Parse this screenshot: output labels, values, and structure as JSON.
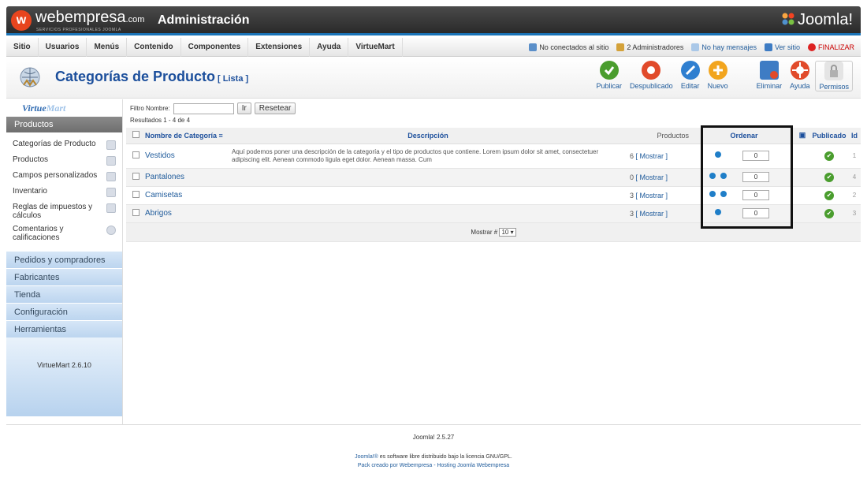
{
  "header": {
    "brand_text": "webempresa",
    "brand_suffix": ".com",
    "brand_sub": "SERVICIOS PROFESIONALES JOOMLA",
    "admin_title": "Administración",
    "joomla_label": "Joomla!"
  },
  "menu": {
    "items": [
      "Sitio",
      "Usuarios",
      "Menús",
      "Contenido",
      "Componentes",
      "Extensiones",
      "Ayuda",
      "VirtueMart"
    ]
  },
  "status": {
    "not_connected": "No conectados al sitio",
    "admins": "2 Administradores",
    "messages": "No hay mensajes",
    "view_site": "Ver sitio",
    "logout": "FINALIZAR"
  },
  "title": {
    "text": "Categorías de Producto",
    "suffix": "[ Lista ]"
  },
  "toolbar": {
    "publish": "Publicar",
    "unpublish": "Despublicado",
    "edit": "Editar",
    "new": "Nuevo",
    "delete": "Eliminar",
    "help": "Ayuda",
    "permissions": "Permisos"
  },
  "sidebar": {
    "logo_main": "Virtue",
    "logo_tail": "Mart",
    "heading": "Productos",
    "sub_items": [
      {
        "label": "Categorías de Producto",
        "icon": "folder-icon"
      },
      {
        "label": "Productos",
        "icon": "product-icon"
      },
      {
        "label": "Campos personalizados",
        "icon": "custom-fields-icon"
      },
      {
        "label": "Inventario",
        "icon": "inventory-icon"
      },
      {
        "label": "Reglas de impuestos y cálculos",
        "icon": "tax-icon"
      },
      {
        "label": "Comentarios y calificaciones",
        "icon": "comment-icon"
      }
    ],
    "sections": [
      "Pedidos y compradores",
      "Fabricantes",
      "Tienda",
      "Configuración",
      "Herramientas"
    ],
    "version": "VirtueMart 2.6.10"
  },
  "filter": {
    "label": "Filtro Nombre:",
    "value": "",
    "go": "Ir",
    "reset": "Resetear",
    "results": "Resultados 1 - 4 de 4"
  },
  "table": {
    "headers": {
      "name": "Nombre de Categoría",
      "description": "Descripción",
      "products": "Productos",
      "order": "Ordenar",
      "published": "Publicado",
      "id": "Id"
    },
    "rows": [
      {
        "name": "Vestidos",
        "description": "Aquí podemos poner una descripción de la categoría y el tipo de productos que contiene. Lorem ipsum dolor sit amet, consectetuer adipiscing elit. Aenean commodo ligula eget dolor. Aenean massa. Cum",
        "count": "6",
        "show": "[ Mostrar ]",
        "order": "0",
        "id": "1"
      },
      {
        "name": "Pantalones",
        "description": "",
        "count": "0",
        "show": "[ Mostrar ]",
        "order": "0",
        "id": "4"
      },
      {
        "name": "Camisetas",
        "description": "",
        "count": "3",
        "show": "[ Mostrar ]",
        "order": "0",
        "id": "2"
      },
      {
        "name": "Abrigos",
        "description": "",
        "count": "3",
        "show": "[ Mostrar ]",
        "order": "0",
        "id": "3"
      }
    ],
    "show_label": "Mostrar #",
    "show_value": "10"
  },
  "footer": {
    "version": "Joomla! 2.5.27",
    "license_link": "Joomla!®",
    "license_text": " es software libre distribuido bajo la licencia GNU/GPL.",
    "pack_text": "Pack creado por Webempresa - Hosting Joomla Webempresa"
  }
}
